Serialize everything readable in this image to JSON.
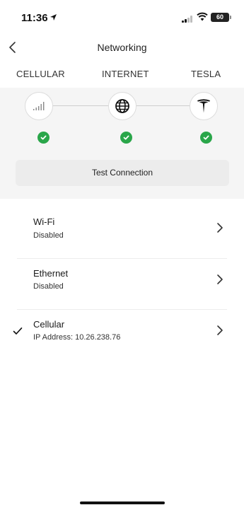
{
  "status_bar": {
    "time": "11:36",
    "battery": "60"
  },
  "header": {
    "title": "Networking"
  },
  "connection": {
    "nodes": [
      {
        "label": "CELLULAR",
        "status": "connected"
      },
      {
        "label": "INTERNET",
        "status": "connected"
      },
      {
        "label": "TESLA",
        "status": "connected"
      }
    ],
    "test_button_label": "Test Connection",
    "check_color": "#2aa64a"
  },
  "networks": [
    {
      "name": "Wi-Fi",
      "detail": "Disabled",
      "selected": false
    },
    {
      "name": "Ethernet",
      "detail": "Disabled",
      "selected": false
    },
    {
      "name": "Cellular",
      "detail": "IP Address: 10.26.238.76",
      "selected": true
    }
  ]
}
